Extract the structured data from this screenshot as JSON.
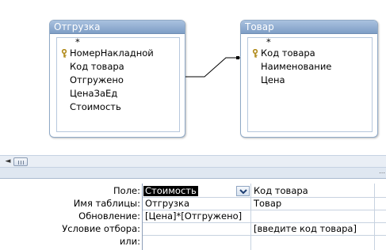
{
  "tables": [
    {
      "title": "Отгрузка",
      "star": "*",
      "fields": [
        "НомерНакладной",
        "Код товара",
        "Отгружено",
        "ЦенаЗаЕд",
        "Стоимость"
      ],
      "key_field": "НомерНакладной"
    },
    {
      "title": "Товар",
      "star": "*",
      "fields": [
        "Код товара",
        "Наименование",
        "Цена"
      ],
      "key_field": "Код товара"
    }
  ],
  "grid": {
    "row_labels": [
      "Поле:",
      "Имя таблицы:",
      "Обновление:",
      "Условие отбора:",
      "или:"
    ],
    "columns": [
      {
        "field": "Стоимость",
        "table": "Отгрузка",
        "update": "[Цена]*[Отгружено]",
        "criteria": "",
        "or": ""
      },
      {
        "field": "Код товара",
        "table": "Товар",
        "update": "",
        "criteria": "[введите код товара]",
        "or": ""
      }
    ]
  },
  "scroll": {
    "left_arrow": "◄"
  },
  "splitter": {
    "dots": "⋯"
  },
  "colors": {
    "title_bar": "#8aa6cb",
    "accent_top": "#e9b640",
    "selection": "#000000"
  },
  "icons": {
    "key": "key-icon",
    "dropdown": "chevron-down-icon"
  }
}
